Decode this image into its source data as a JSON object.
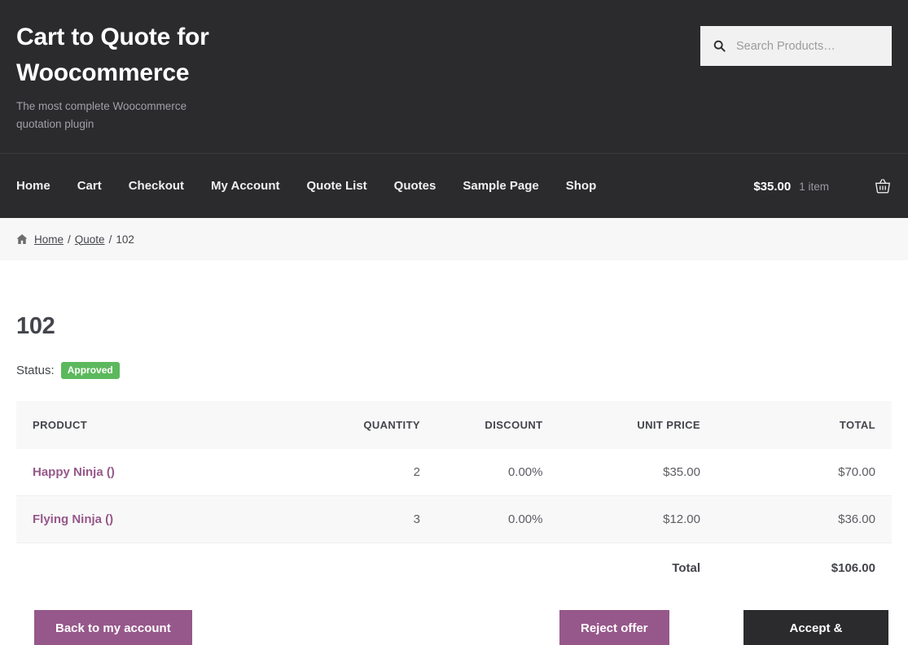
{
  "site": {
    "title": "Cart to Quote for Woocommerce",
    "description": "The most complete Woocommerce quotation plugin"
  },
  "search": {
    "placeholder": "Search Products…",
    "value": "",
    "icon": "search-icon"
  },
  "nav": {
    "items": [
      {
        "label": "Home"
      },
      {
        "label": "Cart"
      },
      {
        "label": "Checkout"
      },
      {
        "label": "My Account"
      },
      {
        "label": "Quote List"
      },
      {
        "label": "Quotes"
      },
      {
        "label": "Sample Page"
      },
      {
        "label": "Shop"
      }
    ],
    "cart": {
      "amount": "$35.00",
      "count": "1 item",
      "icon": "shopping-basket-icon"
    }
  },
  "breadcrumb": {
    "home_icon": "home-icon",
    "home": "Home",
    "sep1": "/",
    "parent": "Quote",
    "sep2": "/",
    "current": "102"
  },
  "quote": {
    "title": "102",
    "status_label": "Status:",
    "status_value": "Approved",
    "status_color": "#5cb85c"
  },
  "table": {
    "headers": {
      "product": "PRODUCT",
      "quantity": "QUANTITY",
      "discount": "DISCOUNT",
      "unit_price": "UNIT PRICE",
      "total": "TOTAL"
    },
    "rows": [
      {
        "product": "Happy Ninja ()",
        "quantity": "2",
        "discount": "0.00%",
        "unit_price": "$35.00",
        "total": "$70.00"
      },
      {
        "product": "Flying Ninja ()",
        "quantity": "3",
        "discount": "0.00%",
        "unit_price": "$12.00",
        "total": "$36.00"
      }
    ],
    "footer": {
      "label": "Total",
      "value": "$106.00"
    }
  },
  "actions": {
    "back": "Back to my account",
    "reject": "Reject offer",
    "accept": "Accept & Checkout",
    "purple": "#96588a",
    "dark": "#2b2b2e"
  }
}
